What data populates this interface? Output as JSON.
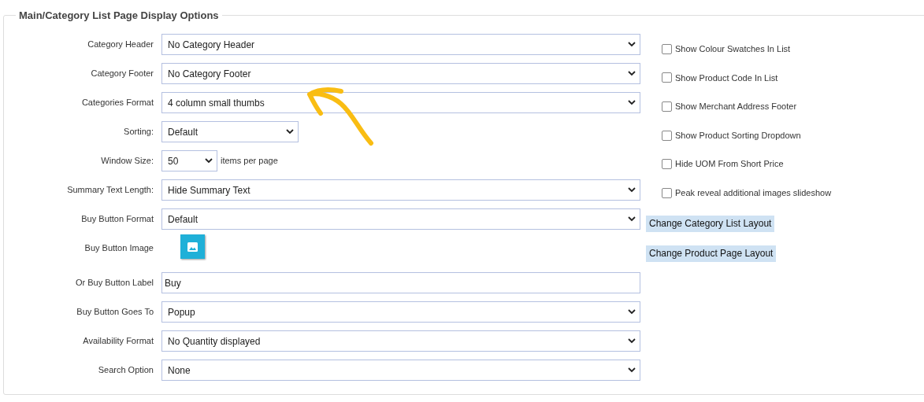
{
  "section": {
    "title": "Main/Category List Page Display Options"
  },
  "rows": [
    {
      "kind": "select",
      "label": "Category Header",
      "value": "No Category Header"
    },
    {
      "kind": "select",
      "label": "Category Footer",
      "value": "No Category Footer"
    },
    {
      "kind": "select",
      "label": "Categories Format",
      "value": "4 column small thumbs"
    },
    {
      "kind": "short_select",
      "label": "Sorting:",
      "value": "Default"
    },
    {
      "kind": "tiny_select",
      "label": "Window Size:",
      "value": "50",
      "suffix": "items per page"
    },
    {
      "kind": "select",
      "label": "Summary Text Length:",
      "value": "Hide Summary Text"
    },
    {
      "kind": "select",
      "label": "Buy Button Format",
      "value": "Default"
    },
    {
      "kind": "image",
      "label": "Buy Button Image"
    },
    {
      "kind": "input",
      "label": "Or Buy Button Label",
      "value": "Buy"
    },
    {
      "kind": "select",
      "label": "Buy Button Goes To",
      "value": "Popup"
    },
    {
      "kind": "select",
      "label": "Availability Format",
      "value": "No Quantity displayed"
    },
    {
      "kind": "select",
      "label": "Search Option",
      "value": "None"
    }
  ],
  "checkboxes": [
    {
      "label": "Show Colour Swatches In List",
      "checked": false
    },
    {
      "label": "Show Product Code In List",
      "checked": false
    },
    {
      "label": "Show Merchant Address Footer",
      "checked": false
    },
    {
      "label": "Show Product Sorting Dropdown",
      "checked": false
    },
    {
      "label": "Hide UOM From Short Price",
      "checked": false
    },
    {
      "label": "Peak reveal additional images slideshow",
      "checked": false
    }
  ],
  "buttons": [
    "Change Category List Layout",
    "Change Product Page Layout"
  ]
}
